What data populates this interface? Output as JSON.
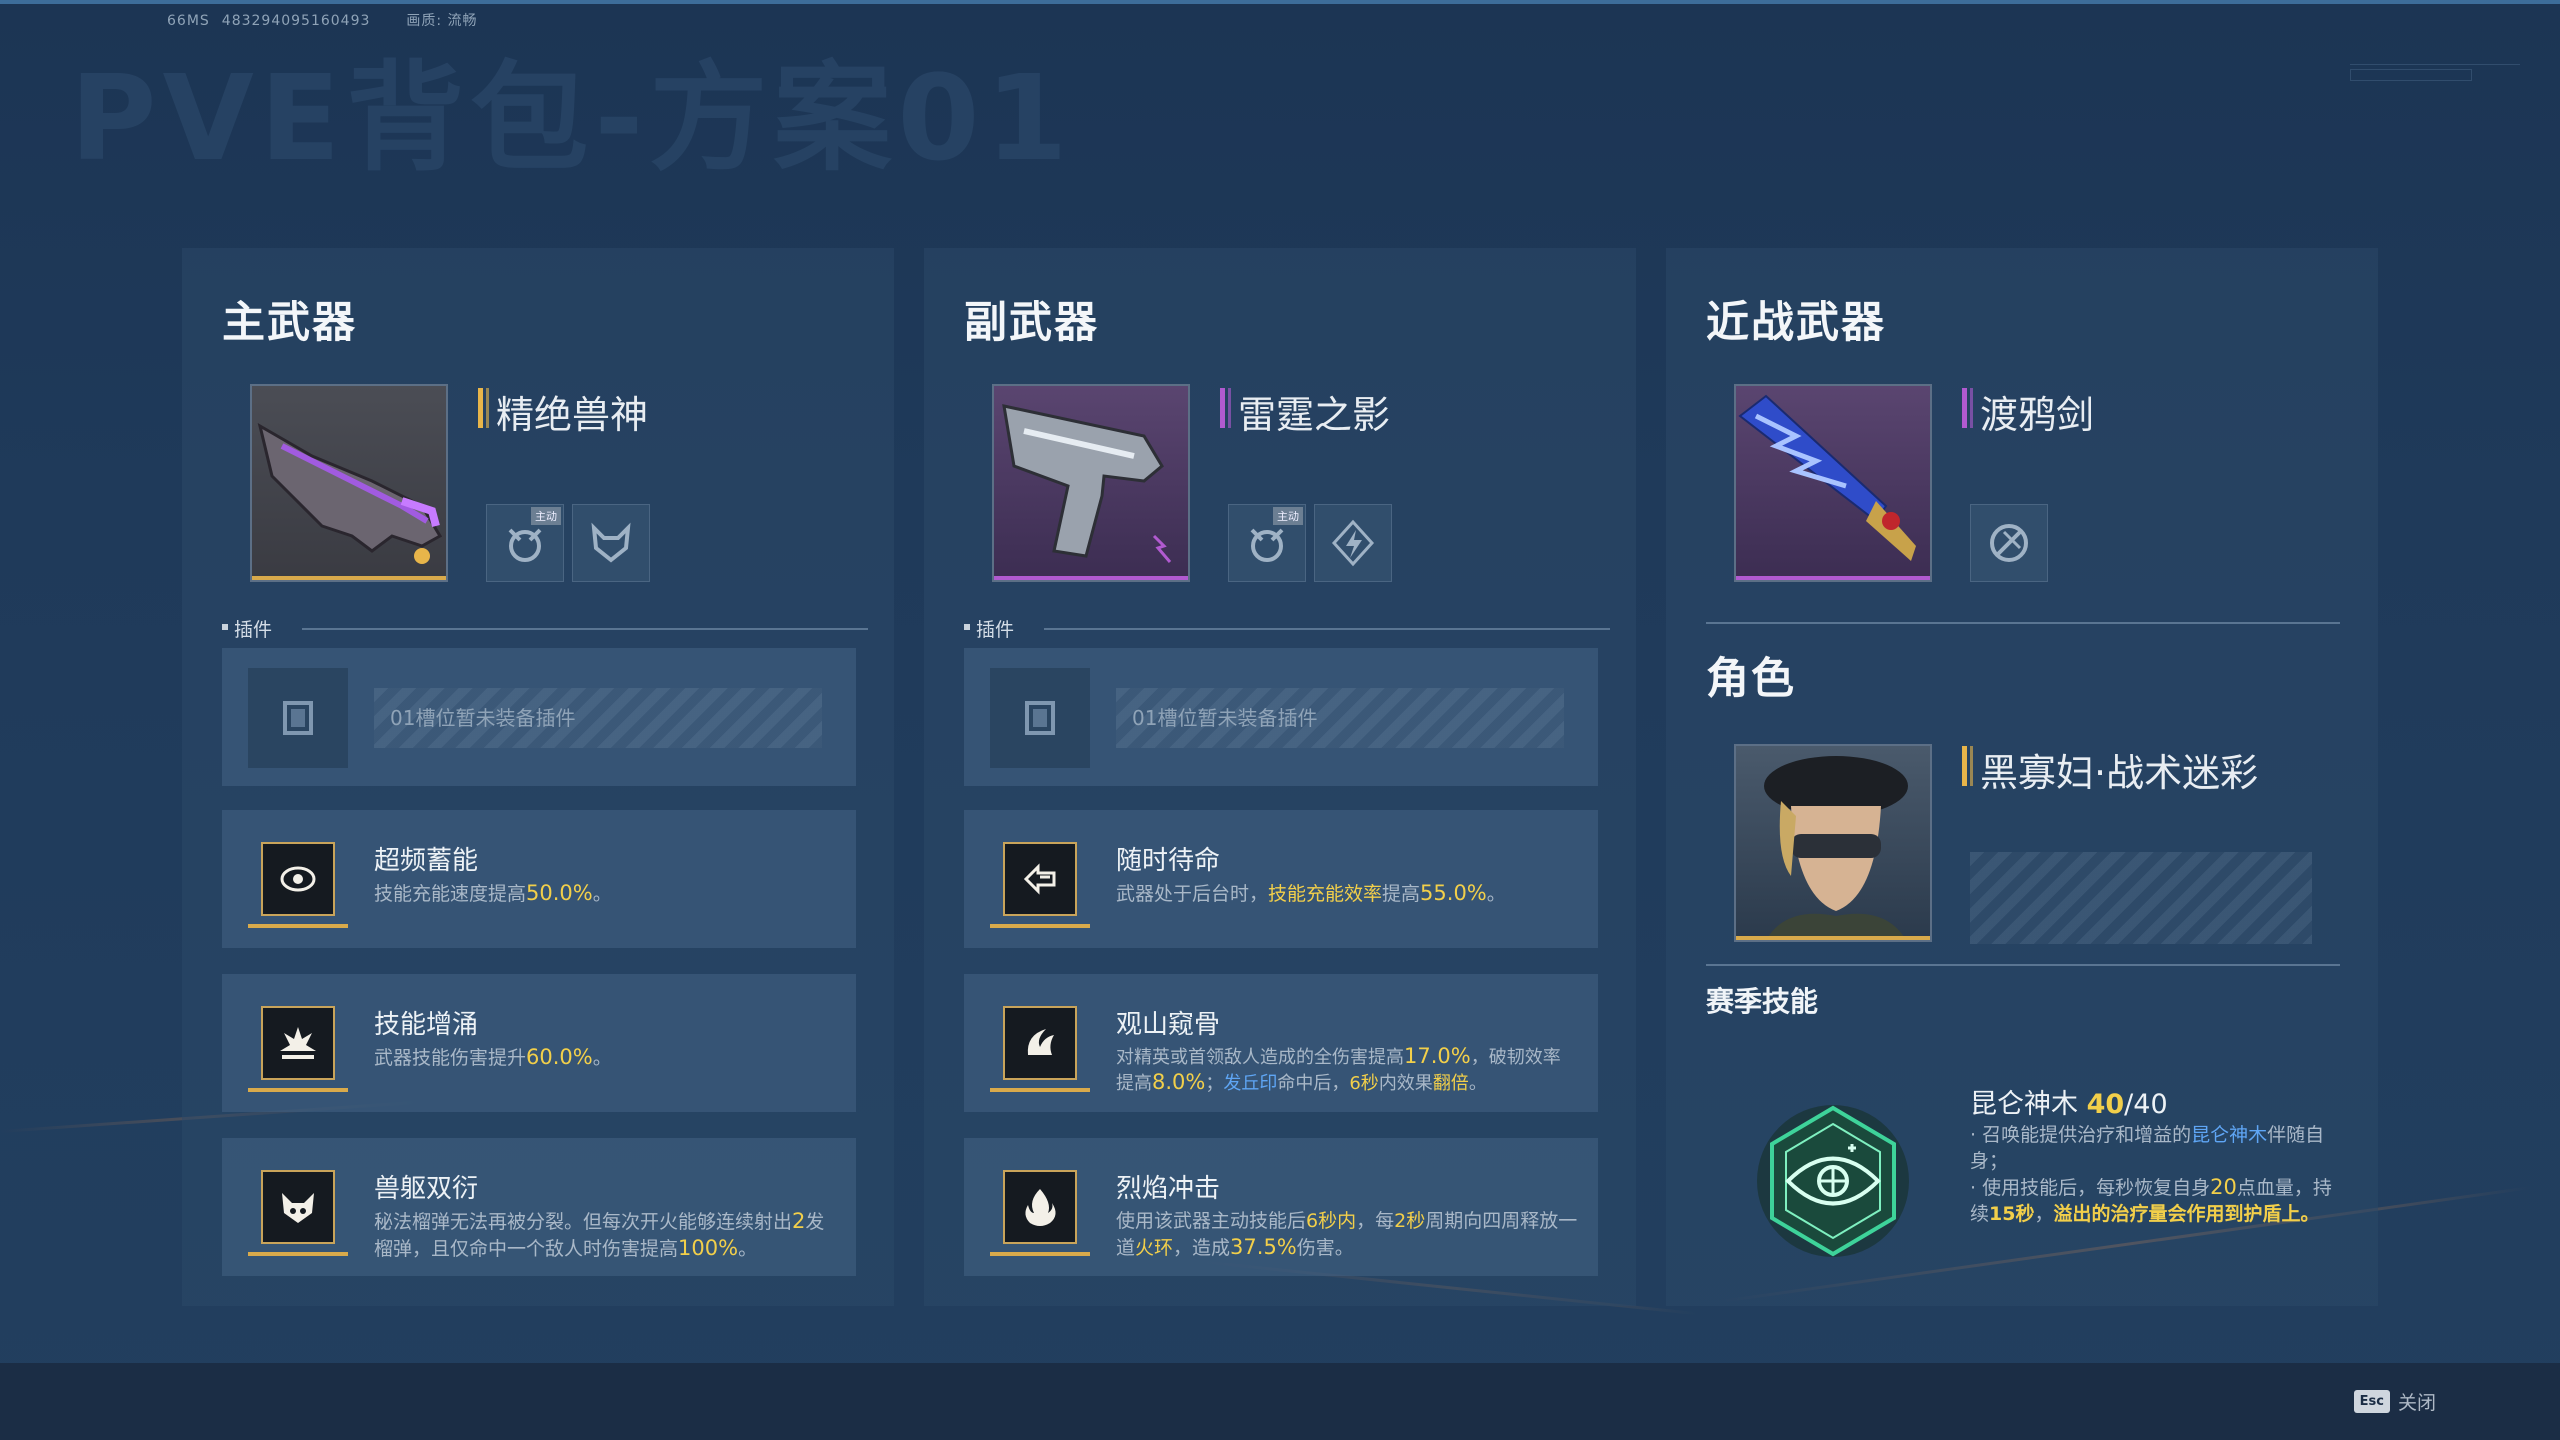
{
  "debug": {
    "fps": "66MS",
    "uid": "483294095160493",
    "quality": "画质: 流畅"
  },
  "page_title": "PVE背包-方案01",
  "footer": {
    "esc_key": "Esc",
    "close_label": "关闭"
  },
  "primary": {
    "heading": "主武器",
    "name": "精绝兽神",
    "skill_tag": "主动",
    "plugins_label": "插件",
    "slot_text": "01槽位暂未装备插件",
    "perks": [
      {
        "title": "超频蓄能",
        "d1": "技能充能速度提高",
        "v1": "50.0%",
        "d2": "。"
      },
      {
        "title": "技能增涌",
        "d1": "武器技能伤害提升",
        "v1": "60.0%",
        "d2": "。"
      },
      {
        "title": "兽躯双衍",
        "d1": "秘法榴弹无法再被分裂。但每次开火能够连续射出",
        "v1": "2",
        "d2": "发榴弹，且仅命中一个敌人时伤害提高",
        "v2": "100%",
        "d3": "。"
      }
    ]
  },
  "secondary": {
    "heading": "副武器",
    "name": "雷霆之影",
    "skill_tag": "主动",
    "plugins_label": "插件",
    "slot_text": "01槽位暂未装备插件",
    "perks": [
      {
        "title": "随时待命",
        "d1": "武器处于后台时，",
        "k1": "技能充能效率",
        "d2": "提高",
        "v1": "55.0%",
        "d3": "。"
      },
      {
        "title": "观山窥骨",
        "d1": "对精英或首领敌人造成的全伤害提高",
        "v1": "17.0%",
        "d2": "，破韧效率提高",
        "v2": "8.0%",
        "d3": "；",
        "k1": "发丘印",
        "d4": "命中后，",
        "v3": "6秒",
        "d5": "内效果",
        "k2": "翻倍",
        "d6": "。"
      },
      {
        "title": "烈焰冲击",
        "d1": "使用该武器主动技能后",
        "v1": "6秒内",
        "d2": "，每",
        "v2": "2秒",
        "d3": "周期向四周释放一道",
        "k1": "火环",
        "d4": "，造成",
        "v3": "37.5%",
        "d5": "伤害。"
      }
    ]
  },
  "melee": {
    "heading": "近战武器",
    "name": "渡鸦剑"
  },
  "role": {
    "heading": "角色",
    "name": "黑寡妇·战术迷彩",
    "season_heading": "赛季技能",
    "skill_name": "昆仑神木",
    "skill_level": "40",
    "skill_level_max": "/40",
    "d1": "· 召唤能提供治疗和增益的",
    "k1": "昆仑神木",
    "d2": "伴随自身；",
    "d3": "· 使用技能后，每秒恢复自身",
    "v1": "20",
    "d4": "点血量，持续",
    "v2": "15秒",
    "d5": "，",
    "k2": "溢出的治疗量会作用到护盾上。"
  },
  "colors": {
    "gold": "#e8b54a",
    "purple": "#b15ad0",
    "highlight_yellow": "#f2cf4a",
    "highlight_blue": "#5fa6f5"
  }
}
